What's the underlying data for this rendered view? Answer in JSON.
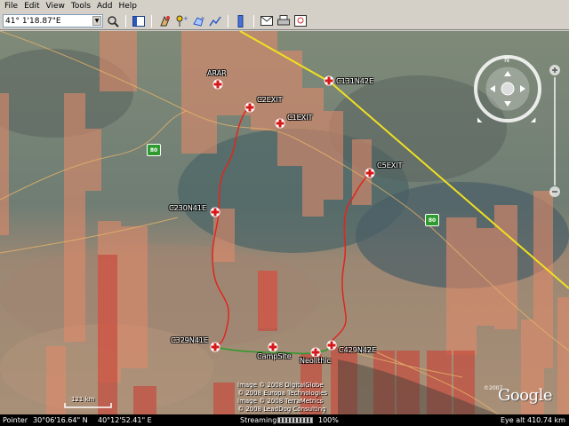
{
  "menu": {
    "items": [
      "File",
      "Edit",
      "View",
      "Tools",
      "Add",
      "Help"
    ]
  },
  "toolbar": {
    "search_value": "41° 1'18.87\"E",
    "buttons": [
      {
        "name": "search-go-icon"
      },
      {
        "name": "sidebar-toggle-icon"
      },
      {
        "name": "hand-tool-icon"
      },
      {
        "name": "add-placemark-icon"
      },
      {
        "name": "add-polygon-icon"
      },
      {
        "name": "add-path-icon"
      },
      {
        "name": "ruler-icon"
      },
      {
        "name": "email-icon"
      },
      {
        "name": "print-icon"
      },
      {
        "name": "view-in-maps-icon"
      }
    ]
  },
  "placemarks": [
    {
      "label": "ARAR"
    },
    {
      "label": "C2EXIT"
    },
    {
      "label": "C1EXIT"
    },
    {
      "label": "C131N42E"
    },
    {
      "label": "C5EXIT"
    },
    {
      "label": "C230N41E"
    },
    {
      "label": "C329N41E"
    },
    {
      "label": "CampSite"
    },
    {
      "label": "Neolithic"
    },
    {
      "label": "C429N42E"
    }
  ],
  "attribution": {
    "lines": [
      "Image © 2008 DigitalGlobe",
      "© 2008 Europa Technologies",
      "Image © 2008 TerraMetrics",
      "© 2008 LeadDog Consulting"
    ],
    "copyright_year": "©2007",
    "logo": "Google"
  },
  "scale": {
    "label": "121 km"
  },
  "status": {
    "pointer_label": "Pointer",
    "pointer_lat": "30°06'16.64\" N",
    "pointer_lon": "40°12'52.41\" E",
    "streaming_label": "Streaming",
    "streaming_pct": "100%",
    "streaming_value": 1.0,
    "eye_alt_label": "Eye alt",
    "eye_alt_value": "410.74 km"
  },
  "colors": {
    "route": "#e0261e",
    "border_line": "#f0e020",
    "placemark": "#d81818"
  }
}
